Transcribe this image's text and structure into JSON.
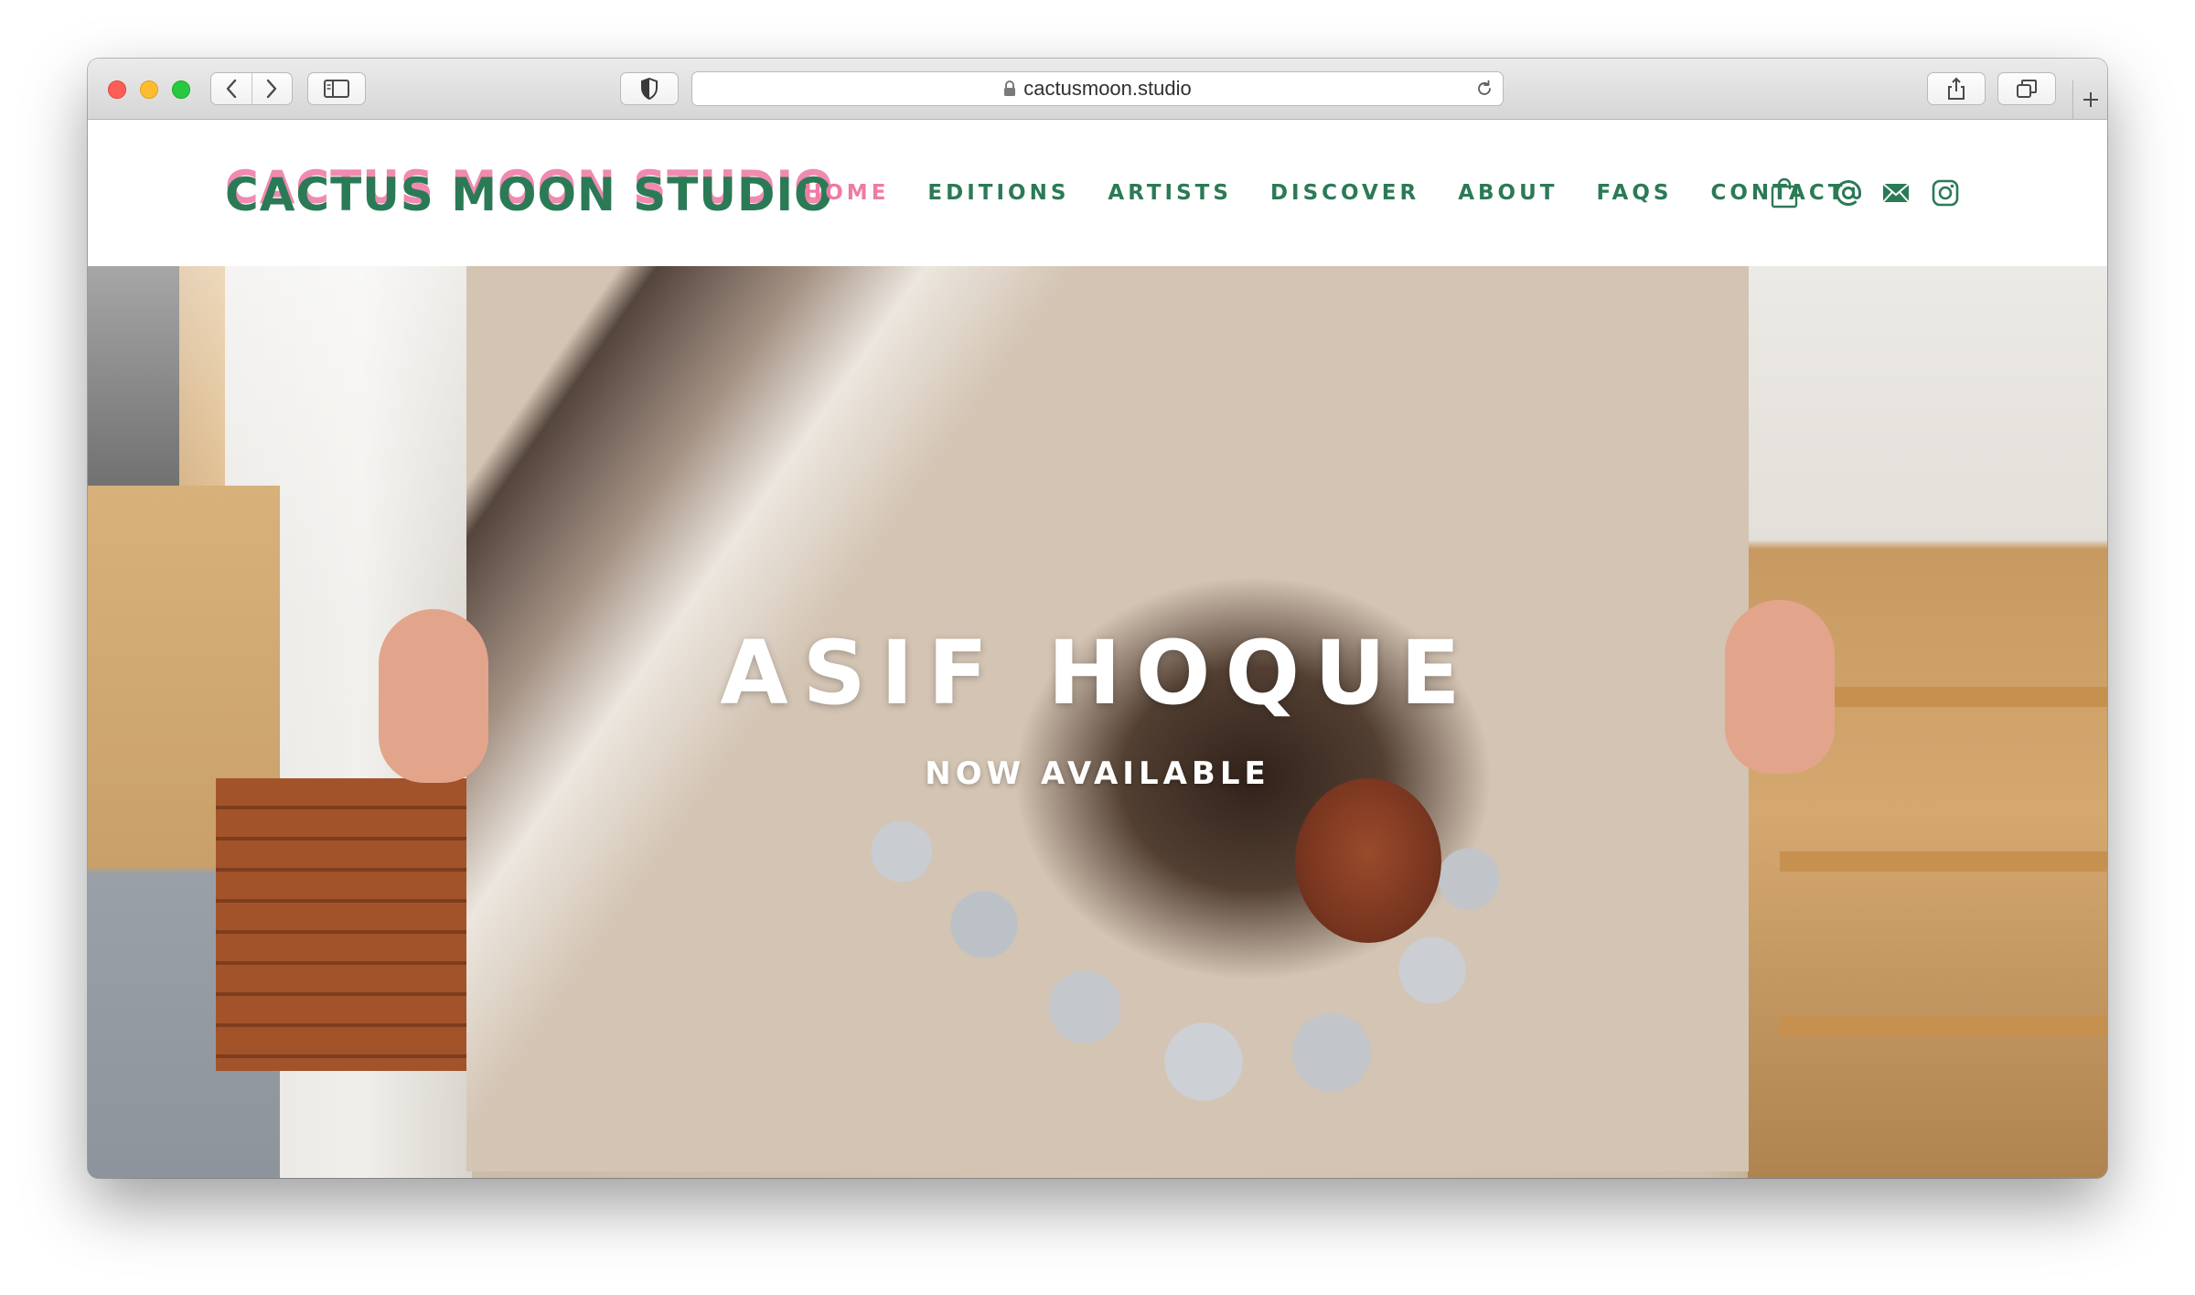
{
  "browser": {
    "url": "cactusmoon.studio",
    "icons": [
      "back-icon",
      "forward-icon",
      "sidebar-icon",
      "shield-icon",
      "lock-icon",
      "reload-icon",
      "share-icon",
      "tabs-icon",
      "plus-icon"
    ]
  },
  "site": {
    "logo": "CACTUS MOON STUDIO",
    "nav": [
      "HOME",
      "EDITIONS",
      "ARTISTS",
      "DISCOVER",
      "ABOUT",
      "FAQS",
      "CONTACT"
    ],
    "active_nav": "HOME",
    "header_icons": [
      "shopping-bag-icon",
      "at-icon",
      "mail-icon",
      "instagram-icon"
    ],
    "colors": {
      "brand_green": "#2b7a56",
      "brand_pink": "#f07aa3"
    }
  },
  "hero": {
    "title": "ASIF HOQUE",
    "subtitle": "NOW AVAILABLE"
  }
}
